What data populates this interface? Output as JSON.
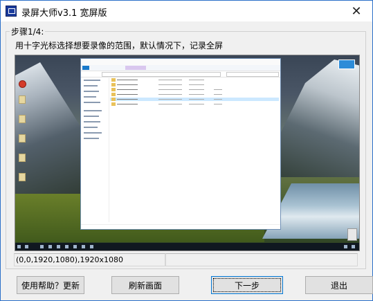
{
  "window": {
    "title": "录屏大师v3.1 宽屏版",
    "close_glyph": "✕"
  },
  "step": {
    "legend": "步骤1/4:",
    "instruction": "用十字光标选择想要录像的范围，默认情况下，记录全屏"
  },
  "preview": {
    "content": "desktop-screenshot-thumbnail"
  },
  "status": {
    "region_text": "(0,0,1920,1080),1920x1080",
    "secondary_text": ""
  },
  "buttons": {
    "help_label": "使用帮助？更新",
    "refresh_label": "刷新画面",
    "next_label": "下一步",
    "exit_label": "退出"
  },
  "colors": {
    "window_border": "#2b6fc9",
    "focus_border": "#0078d7",
    "button_face": "#e1e1e1"
  }
}
